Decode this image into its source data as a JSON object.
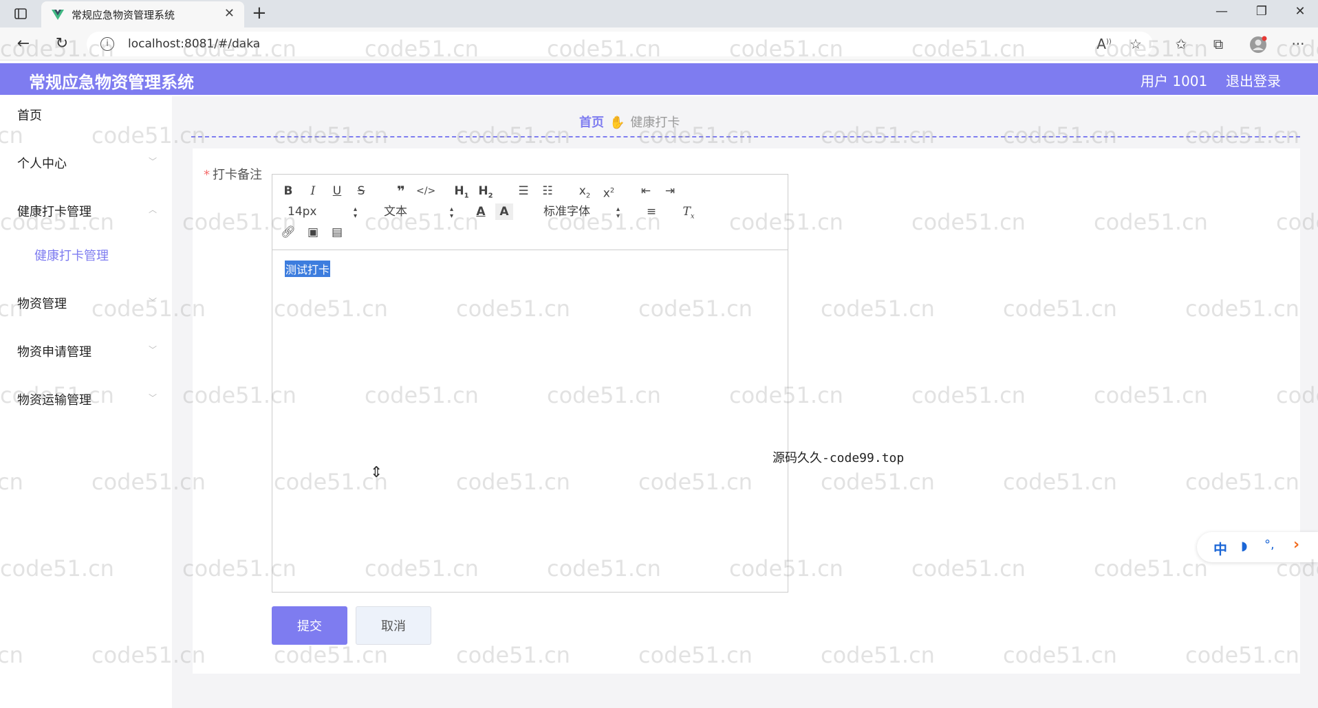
{
  "browser": {
    "tab_title": "常规应急物资管理系统",
    "url": "localhost:8081/#/daka",
    "new_tab": "+",
    "close": "✕"
  },
  "header": {
    "title": "常规应急物资管理系统",
    "user": "用户 1001",
    "logout": "退出登录"
  },
  "sidebar": {
    "items": [
      {
        "label": "首页"
      },
      {
        "label": "个人中心"
      },
      {
        "label": "健康打卡管理"
      },
      {
        "label": "健康打卡管理"
      },
      {
        "label": "物资管理"
      },
      {
        "label": "物资申请管理"
      },
      {
        "label": "物资运输管理"
      }
    ]
  },
  "breadcrumb": {
    "home": "首页",
    "current": "健康打卡"
  },
  "form": {
    "required_mark": "*",
    "label": "打卡备注",
    "toolbar": {
      "font_size": "14px",
      "header_type": "文本",
      "font_family": "标准字体"
    },
    "content": "测试打卡",
    "submit": "提交",
    "cancel": "取消"
  },
  "overlay": {
    "source_text": "源码久久-code99.top"
  },
  "ime": {
    "mode": "中"
  },
  "watermark": {
    "text": "code51.cn",
    "partial": "cn",
    "partial_left": "cod"
  }
}
